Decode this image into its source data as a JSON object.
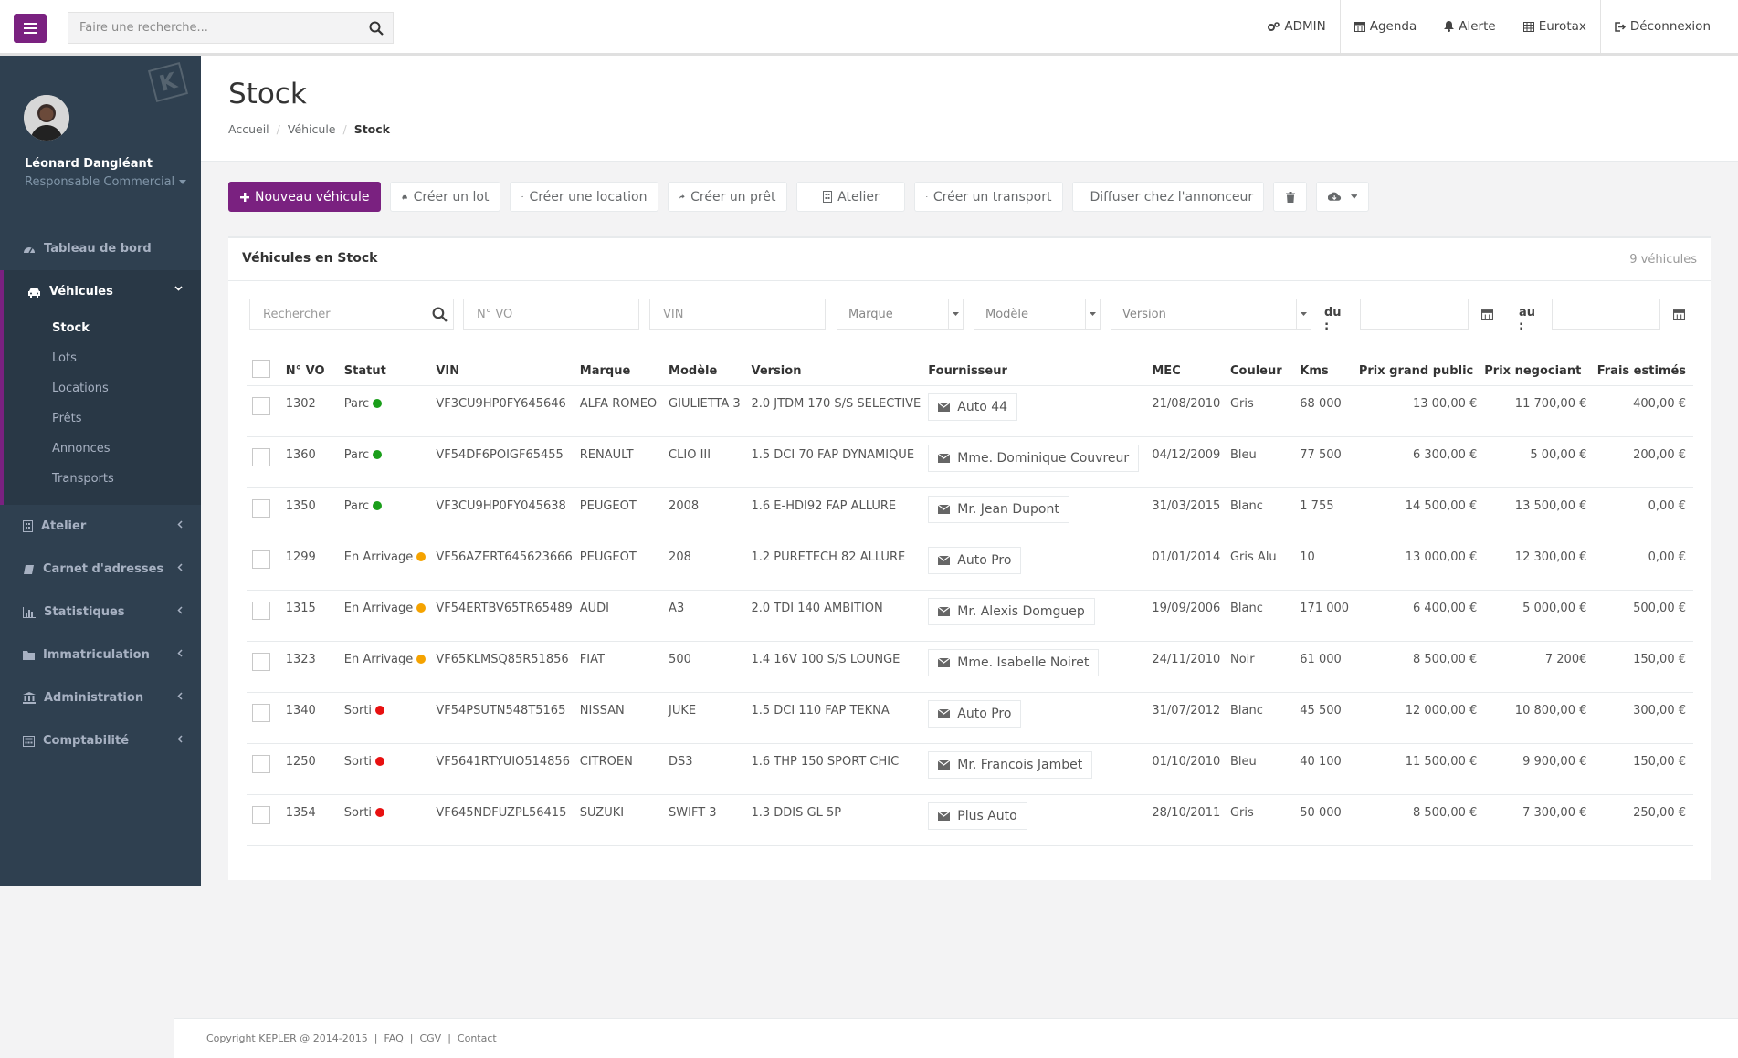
{
  "topbar": {
    "search_placeholder": "Faire une recherche...",
    "nav": [
      "ADMIN",
      "Agenda",
      "Alerte",
      "Eurotax",
      "Déconnexion"
    ]
  },
  "sidebar": {
    "user_name": "Léonard Dangléant",
    "user_role": "Responsable Commercial",
    "logo_letter": "K",
    "items": {
      "dashboard": "Tableau de bord",
      "vehicules": "Véhicules",
      "atelier": "Atelier",
      "carnet": "Carnet d'adresses",
      "stats": "Statistiques",
      "immat": "Immatriculation",
      "admin": "Administration",
      "compta": "Comptabilité"
    },
    "vehicules_sub": [
      "Stock",
      "Lots",
      "Locations",
      "Prêts",
      "Annonces",
      "Transports"
    ]
  },
  "page": {
    "title": "Stock",
    "breadcrumb": [
      "Accueil",
      "Véhicule",
      "Stock"
    ]
  },
  "toolbar": {
    "new": "Nouveau véhicule",
    "lot": "Créer un lot",
    "location": "Créer une location",
    "pret": "Créer un prêt",
    "atelier": "Atelier",
    "transport": "Créer un transport",
    "diffuser": "Diffuser chez l'annonceur"
  },
  "panel": {
    "title": "Véhicules en Stock",
    "count": "9 véhicules"
  },
  "filters": {
    "search": "Rechercher",
    "vo": "N° VO",
    "vin": "VIN",
    "marque": "Marque",
    "modele": "Modèle",
    "version": "Version",
    "du": "du :",
    "au": "au :"
  },
  "table": {
    "headers": [
      "N° VO",
      "Statut",
      "VIN",
      "Marque",
      "Modèle",
      "Version",
      "Fournisseur",
      "MEC",
      "Couleur",
      "Kms",
      "Prix grand public",
      "Prix negociant",
      "Frais estimés"
    ],
    "rows": [
      {
        "vo": "1302",
        "statut": "Parc",
        "status_color": "#1a9e1a",
        "vin": "VF3CU9HP0FY645646",
        "marque": "ALFA ROMEO",
        "modele": "GIULIETTA 3",
        "version": "2.0 JTDM 170 S/S SELECTIVE",
        "fournisseur": "Auto 44",
        "mec": "21/08/2010",
        "couleur": "Gris",
        "kms": "68 000",
        "prix_public": "13 00,00 €",
        "prix_neg": "11 700,00 €",
        "frais": "400,00 €"
      },
      {
        "vo": "1360",
        "statut": "Parc",
        "status_color": "#1a9e1a",
        "vin": "VF54DF6POIGF65455",
        "marque": "RENAULT",
        "modele": "CLIO III",
        "version": "1.5 DCI 70 FAP DYNAMIQUE",
        "fournisseur": "Mme. Dominique Couvreur",
        "mec": "04/12/2009",
        "couleur": "Bleu",
        "kms": "77 500",
        "prix_public": "6 300,00 €",
        "prix_neg": "5 00,00 €",
        "frais": "200,00 €"
      },
      {
        "vo": "1350",
        "statut": "Parc",
        "status_color": "#1a9e1a",
        "vin": "VF3CU9HP0FY045638",
        "marque": "PEUGEOT",
        "modele": "2008",
        "version": "1.6 E-HDI92 FAP ALLURE",
        "fournisseur": "Mr. Jean Dupont",
        "mec": "31/03/2015",
        "couleur": "Blanc",
        "kms": "1 755",
        "prix_public": "14 500,00 €",
        "prix_neg": "13 500,00 €",
        "frais": "0,00 €"
      },
      {
        "vo": "1299",
        "statut": "En Arrivage",
        "status_color": "#f5a300",
        "vin": "VF56AZERT645623666",
        "marque": "PEUGEOT",
        "modele": "208",
        "version": "1.2 PURETECH 82 ALLURE",
        "fournisseur": "Auto Pro",
        "mec": "01/01/2014",
        "couleur": "Gris Alu",
        "kms": "10",
        "prix_public": "13 000,00 €",
        "prix_neg": "12 300,00 €",
        "frais": "0,00 €"
      },
      {
        "vo": "1315",
        "statut": "En Arrivage",
        "status_color": "#f5a300",
        "vin": "VF54ERTBV65TR65489",
        "marque": "AUDI",
        "modele": "A3",
        "version": "2.0 TDI 140 AMBITION",
        "fournisseur": "Mr. Alexis Domguep",
        "mec": "19/09/2006",
        "couleur": "Blanc",
        "kms": "171 000",
        "prix_public": "6 400,00 €",
        "prix_neg": "5 000,00 €",
        "frais": "500,00 €"
      },
      {
        "vo": "1323",
        "statut": "En Arrivage",
        "status_color": "#f5a300",
        "vin": "VF65KLMSQ85R51856",
        "marque": "FIAT",
        "modele": "500",
        "version": "1.4 16V 100 S/S LOUNGE",
        "fournisseur": "Mme. Isabelle Noiret",
        "mec": "24/11/2010",
        "couleur": "Noir",
        "kms": "61 000",
        "prix_public": "8 500,00 €",
        "prix_neg": "7 200€",
        "frais": "150,00 €"
      },
      {
        "vo": "1340",
        "statut": "Sorti",
        "status_color": "#e81010",
        "vin": "VF54PSUTN548T5165",
        "marque": "NISSAN",
        "modele": "JUKE",
        "version": "1.5 DCI 110 FAP TEKNA",
        "fournisseur": "Auto Pro",
        "mec": "31/07/2012",
        "couleur": "Blanc",
        "kms": "45 500",
        "prix_public": "12 000,00 €",
        "prix_neg": "10 800,00 €",
        "frais": "300,00 €"
      },
      {
        "vo": "1250",
        "statut": "Sorti",
        "status_color": "#e81010",
        "vin": "VF5641RTYUIO514856",
        "marque": "CITROEN",
        "modele": "DS3",
        "version": "1.6 THP 150 SPORT CHIC",
        "fournisseur": "Mr. Francois Jambet",
        "mec": "01/10/2010",
        "couleur": "Bleu",
        "kms": "40 100",
        "prix_public": "11 500,00 €",
        "prix_neg": "9 900,00 €",
        "frais": "150,00 €"
      },
      {
        "vo": "1354",
        "statut": "Sorti",
        "status_color": "#e81010",
        "vin": "VF645NDFUZPL56415",
        "marque": "SUZUKI",
        "modele": "SWIFT 3",
        "version": "1.3 DDIS GL 5P",
        "fournisseur": "Plus Auto",
        "mec": "28/10/2011",
        "couleur": "Gris",
        "kms": "50 000",
        "prix_public": "8 500,00 €",
        "prix_neg": "7 300,00 €",
        "frais": "250,00 €"
      }
    ]
  },
  "footer": {
    "copyright": "Copyright KEPLER @ 2014-2015",
    "links": [
      "FAQ",
      "CGV",
      "Contact"
    ]
  },
  "colors": {
    "accent": "#7a2180",
    "sidebar": "#2f4050"
  }
}
